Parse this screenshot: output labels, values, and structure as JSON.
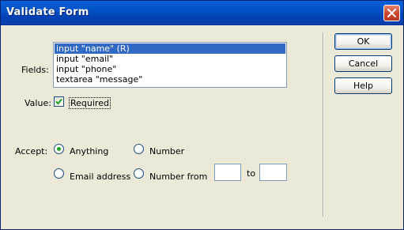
{
  "window": {
    "title": "Validate Form",
    "close_icon": "close-icon"
  },
  "fields": {
    "label": "Fields:",
    "items": [
      "input \"name\" (R)",
      "input \"email\"",
      "input \"phone\"",
      "textarea \"message\""
    ],
    "selected_index": 0
  },
  "value": {
    "label": "Value:",
    "required_label": "Required",
    "required_checked": true
  },
  "accept": {
    "label": "Accept:",
    "options": {
      "anything": "Anything",
      "number": "Number",
      "email": "Email address",
      "number_from": "Number from"
    },
    "selected": "anything",
    "range_from": "",
    "range_to_label": "to",
    "range_to": ""
  },
  "buttons": {
    "ok": "OK",
    "cancel": "Cancel",
    "help": "Help"
  },
  "colors": {
    "title_bar": "#0453c6",
    "selection": "#316ac5",
    "radio_dot": "#21a121",
    "face": "#ece9d8"
  }
}
